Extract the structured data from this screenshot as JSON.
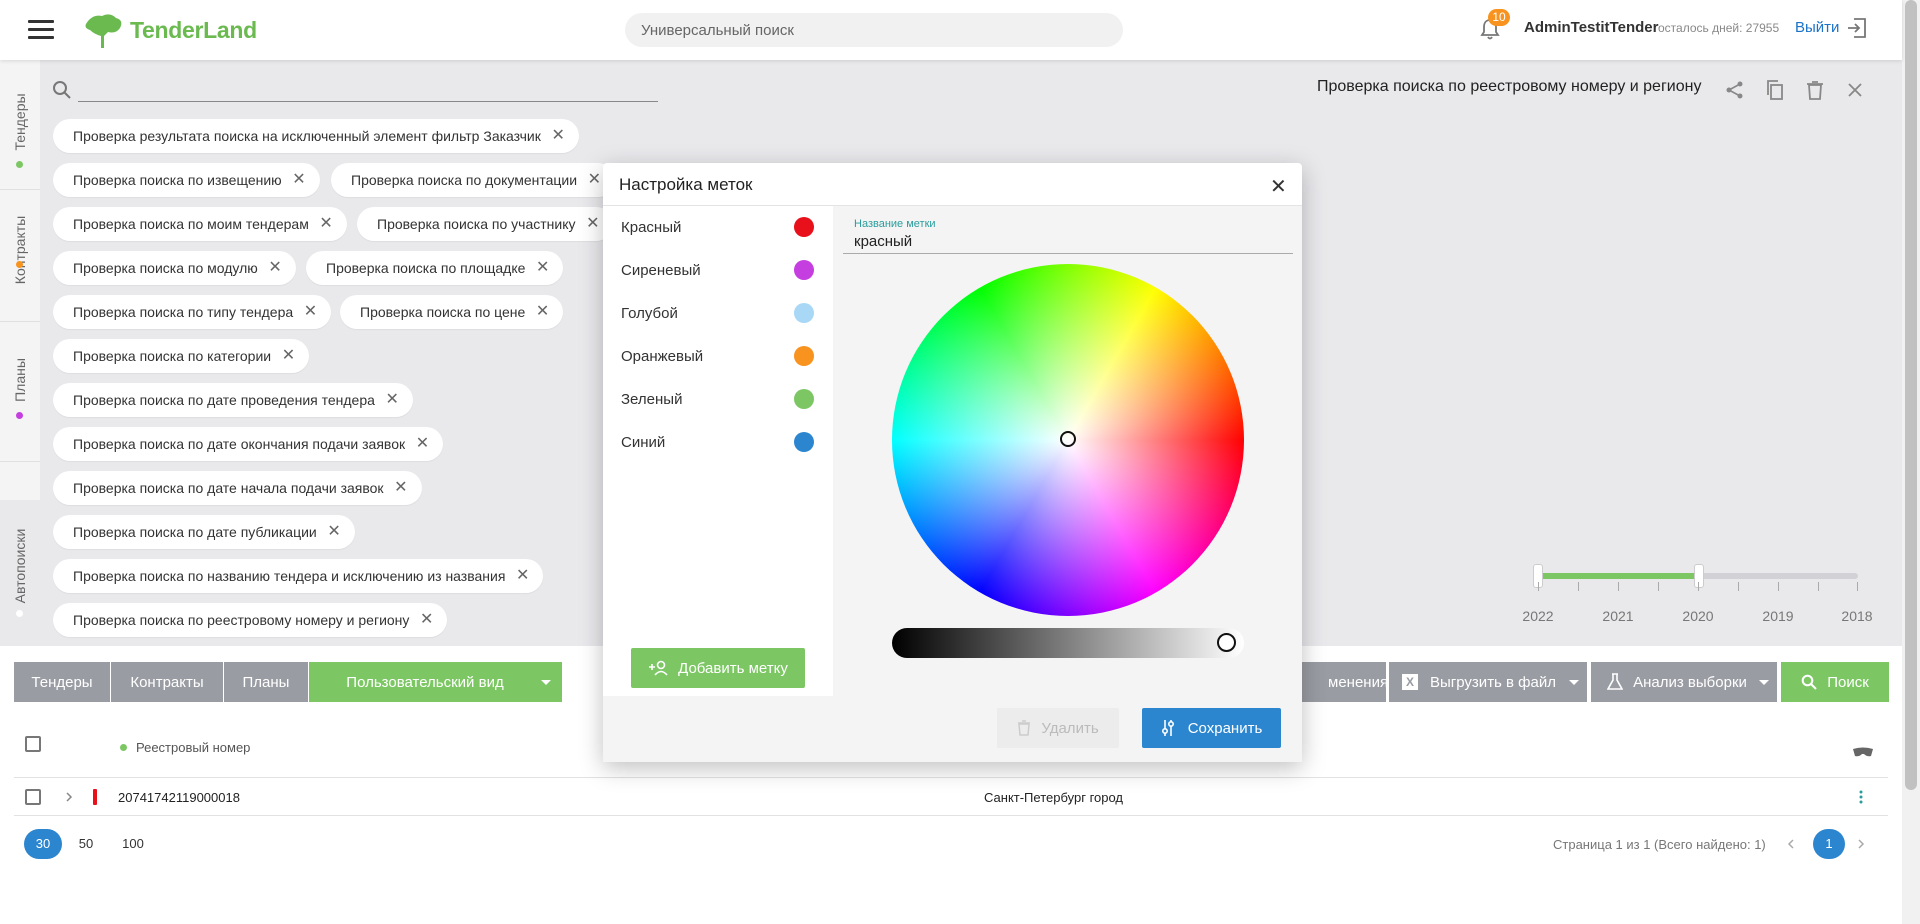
{
  "header": {
    "logo_text": "TenderLand",
    "search_placeholder": "Универсальный поиск",
    "notification_count": "10",
    "username": "AdminTestitTender",
    "days_left": "осталось дней: 27955",
    "logout_label": "Выйти"
  },
  "left_tabs": [
    {
      "label": "Тендеры",
      "dot_color": "#7cc764"
    },
    {
      "label": "Контракты",
      "dot_color": "#f7931e"
    },
    {
      "label": "Планы",
      "dot_color": "#c43ee0"
    },
    {
      "label": "Автопоиски",
      "dot_color": "#ffffff"
    }
  ],
  "autosearches": [
    "Проверка результата поиска на исключенный элемент фильтр Заказчик",
    "Проверка поиска по извещению",
    "Проверка поиска по документации",
    "Проверка поиска по моим тендерам",
    "Проверка поиска по участнику",
    "Проверка поиска по модулю",
    "Проверка поиска по площадке",
    "Проверка поиска по типу тендера",
    "Проверка поиска по цене",
    "Проверка поиска по категории",
    "Проверка поиска по дате проведения тендера",
    "Проверка поиска по дате окончания подачи заявок",
    "Проверка поиска по дате начала подачи заявок",
    "Проверка поиска по дате публикации",
    "Проверка поиска по названию тендера и исключению из названия",
    "Проверка поиска по реестровому номеру и региону"
  ],
  "detail": {
    "title": "Проверка поиска по реестровому номеру и региону"
  },
  "timeline": {
    "years": [
      "2022",
      "2021",
      "2020",
      "2019",
      "2018"
    ],
    "selected_range": [
      "2022",
      "2020"
    ]
  },
  "toolbar": {
    "tab_tenders": "Тендеры",
    "tab_contracts": "Контракты",
    "tab_plans": "Планы",
    "view_label": "Пользовательский вид",
    "changes_label": "менения",
    "export_label": "Выгрузить в файл",
    "analysis_label": "Анализ выборки",
    "search_label": "Поиск"
  },
  "table": {
    "column_header": "Реестровый номер",
    "rows": [
      {
        "number": "207417421190000​18",
        "region": "Санкт-Петербург город",
        "label_color": "#e8101a"
      }
    ]
  },
  "pagination": {
    "sizes": [
      "30",
      "50",
      "100"
    ],
    "active_size": "30",
    "info": "Страница 1 из 1 (Всего найдено: 1)",
    "current_page": "1"
  },
  "modal": {
    "title": "Настройка меток",
    "labels": [
      {
        "name": "Красный",
        "color": "#e8101a"
      },
      {
        "name": "Сиреневый",
        "color": "#c43ee0"
      },
      {
        "name": "Голубой",
        "color": "#a8d8f5"
      },
      {
        "name": "Оранжевый",
        "color": "#f7931e"
      },
      {
        "name": "Зеленый",
        "color": "#7cc764"
      },
      {
        "name": "Синий",
        "color": "#2c86cf"
      }
    ],
    "add_label": "Добавить метку",
    "field_label": "Название метки",
    "field_value": "красный",
    "delete_label": "Удалить",
    "save_label": "Сохранить"
  }
}
